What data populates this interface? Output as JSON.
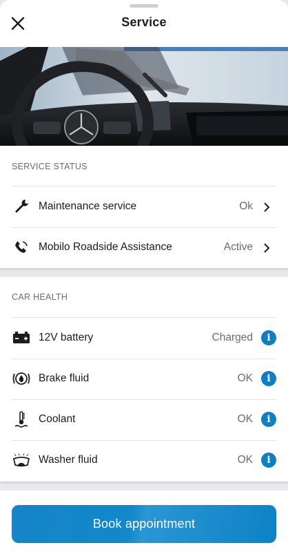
{
  "header": {
    "title": "Service",
    "close_icon": "close-icon"
  },
  "service_status": {
    "heading": "SERVICE STATUS",
    "rows": [
      {
        "label": "Maintenance service",
        "value": "Ok",
        "icon": "wrench-icon"
      },
      {
        "label": "Mobilo Roadside Assistance",
        "value": "Active",
        "icon": "phone-icon"
      }
    ]
  },
  "car_health": {
    "heading": "CAR HEALTH",
    "rows": [
      {
        "label": "12V battery",
        "value": "Charged",
        "icon": "battery-icon"
      },
      {
        "label": "Brake fluid",
        "value": "OK",
        "icon": "brake-fluid-icon"
      },
      {
        "label": "Coolant",
        "value": "OK",
        "icon": "coolant-icon"
      },
      {
        "label": "Washer fluid",
        "value": "OK",
        "icon": "washer-fluid-icon"
      }
    ]
  },
  "footer": {
    "book_label": "Book appointment"
  },
  "colors": {
    "accent": "#0f7fc2",
    "button": "#1288cb",
    "background": "#e9e9ec"
  }
}
